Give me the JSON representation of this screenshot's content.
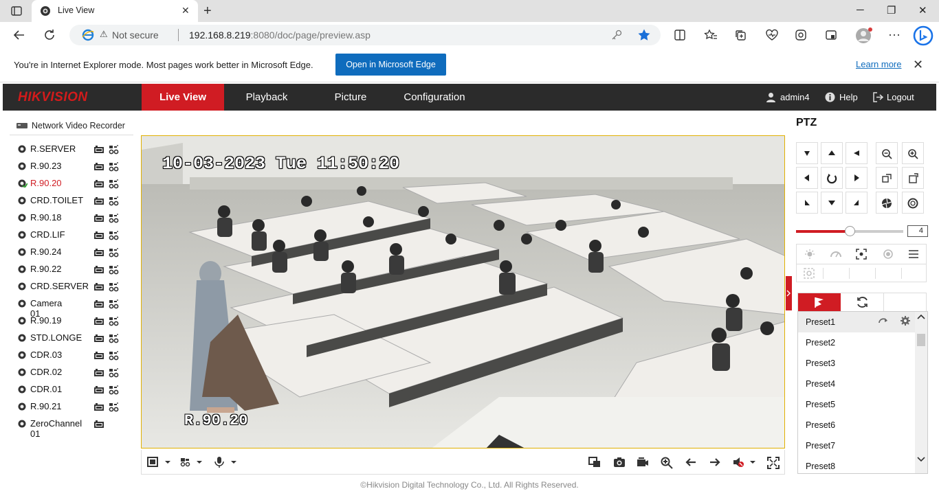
{
  "browser": {
    "tab_title": "Live View",
    "warning": "Not secure",
    "url_host": "192.168.8.219",
    "url_port": ":8080",
    "url_path": "/doc/page/preview.asp"
  },
  "ie_banner": {
    "message": "You're in Internet Explorer mode. Most pages work better in Microsoft Edge.",
    "open_button": "Open in Microsoft Edge",
    "learn_more": "Learn more"
  },
  "hik": {
    "logo": "HIKVISION",
    "nav": [
      "Live View",
      "Playback",
      "Picture",
      "Configuration"
    ],
    "user": "admin4",
    "help": "Help",
    "logout": "Logout"
  },
  "tree": {
    "root": "Network Video Recorder",
    "cameras": [
      {
        "name": "R.SERVER",
        "active": false
      },
      {
        "name": "R.90.23",
        "active": false
      },
      {
        "name": "R.90.20",
        "active": true
      },
      {
        "name": "CRD.TOILET",
        "active": false
      },
      {
        "name": "R.90.18",
        "active": false
      },
      {
        "name": "CRD.LIF",
        "active": false
      },
      {
        "name": "R.90.24",
        "active": false
      },
      {
        "name": "R.90.22",
        "active": false
      },
      {
        "name": "CRD.SERVER",
        "active": false
      },
      {
        "name": "Camera 01",
        "active": false
      },
      {
        "name": "R.90.19",
        "active": false
      },
      {
        "name": "STD.LONGE",
        "active": false
      },
      {
        "name": "CDR.03",
        "active": false
      },
      {
        "name": "CDR.02",
        "active": false
      },
      {
        "name": "CDR.01",
        "active": false
      },
      {
        "name": "R.90.21",
        "active": false
      },
      {
        "name": "ZeroChannel 01",
        "active": false
      }
    ]
  },
  "video": {
    "timestamp": "10-03-2023 Tue 11:50:20",
    "camera_label": "R.90.20"
  },
  "ptz": {
    "title": "PTZ",
    "speed": "4",
    "speed_fraction": 0.5,
    "presets": [
      "Preset1",
      "Preset2",
      "Preset3",
      "Preset4",
      "Preset5",
      "Preset6",
      "Preset7",
      "Preset8"
    ]
  },
  "footer": "©Hikvision Digital Technology Co., Ltd. All Rights Reserved.",
  "colors": {
    "accent": "#d01c23",
    "edge_blue": "#0f6cbd",
    "nav_bg": "#2b2b2b",
    "video_border": "#e0b000"
  }
}
